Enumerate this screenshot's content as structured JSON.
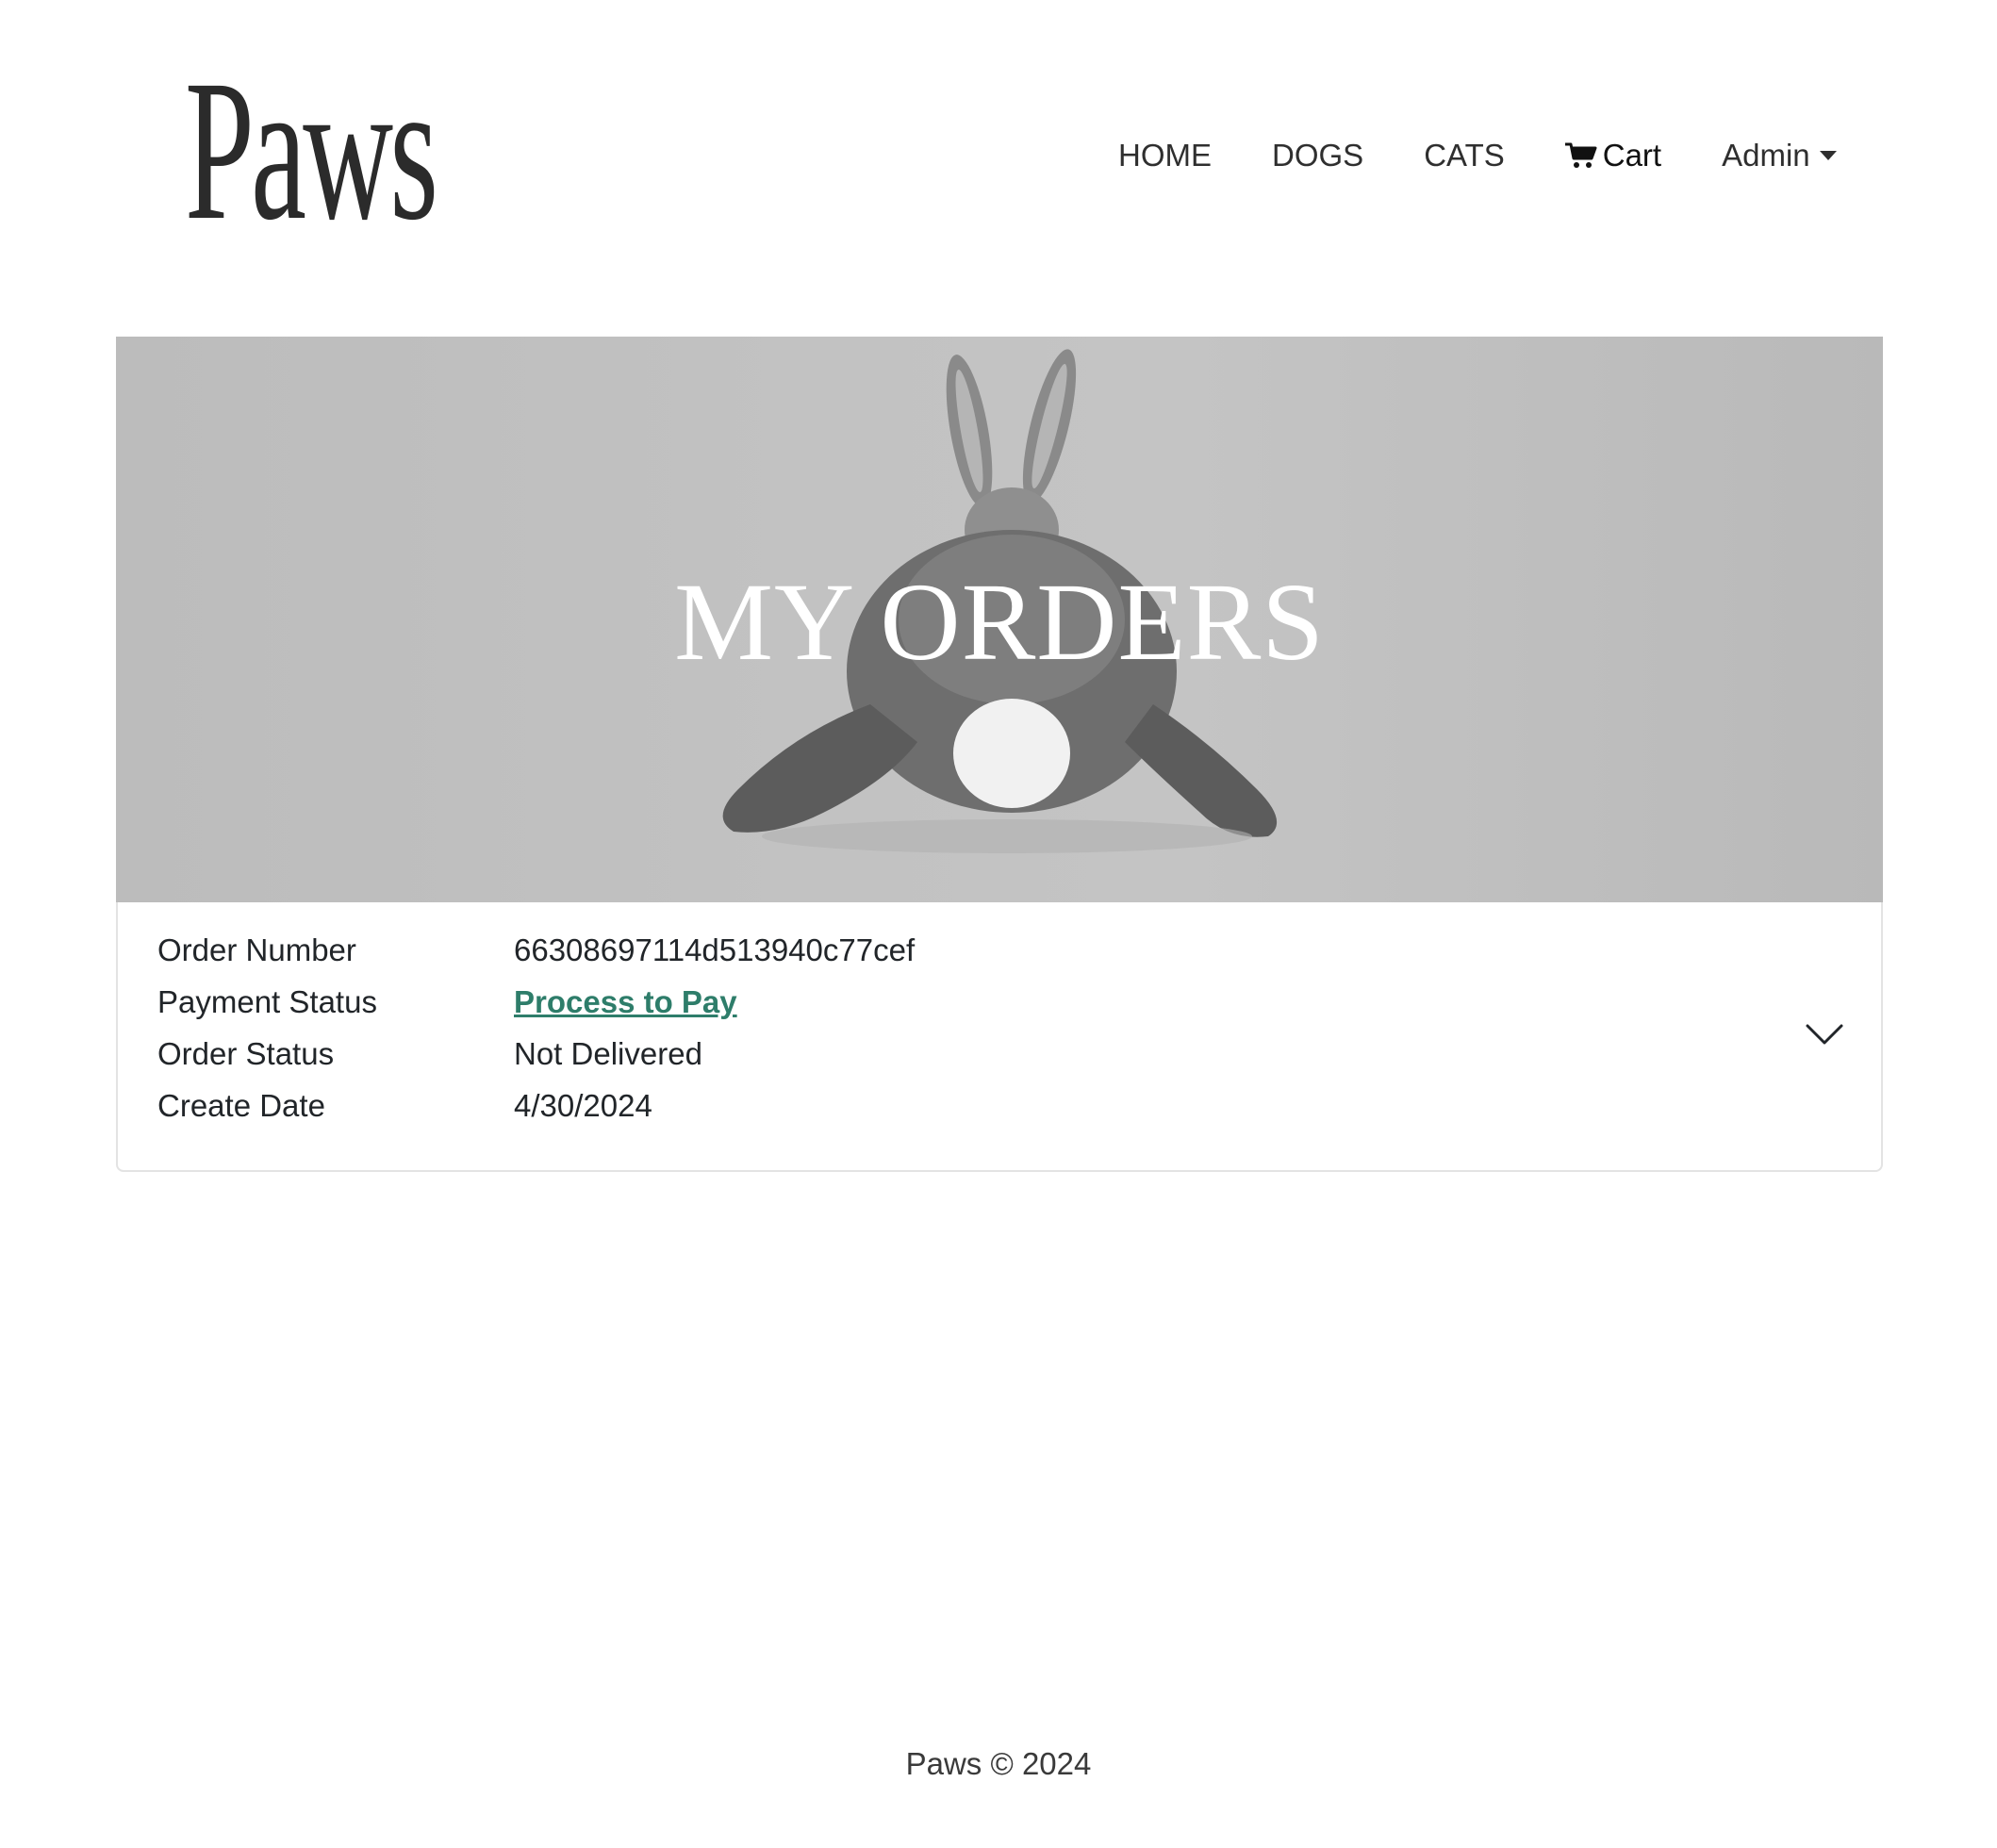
{
  "header": {
    "logo_text": "Paws",
    "nav": {
      "home": "HOME",
      "dogs": "DOGS",
      "cats": "CATS",
      "cart": "Cart",
      "cart_icon": "cart-icon",
      "admin": "Admin",
      "admin_icon": "caret-down-icon"
    }
  },
  "hero": {
    "title": "MY ORDERS"
  },
  "order": {
    "number_label": "Order Number",
    "number_value": "66308697114d513940c77cef",
    "payment_label": "Payment Status",
    "payment_value": "Process to Pay",
    "status_label": "Order Status",
    "status_value": "Not Delivered",
    "date_label": "Create Date",
    "date_value": "4/30/2024",
    "expand_icon": "chevron-down-icon"
  },
  "footer": {
    "text": "Paws © 2024"
  },
  "colors": {
    "link": "#2e7d6a",
    "text": "#212529",
    "hero_bg": "#c2c2c2"
  }
}
